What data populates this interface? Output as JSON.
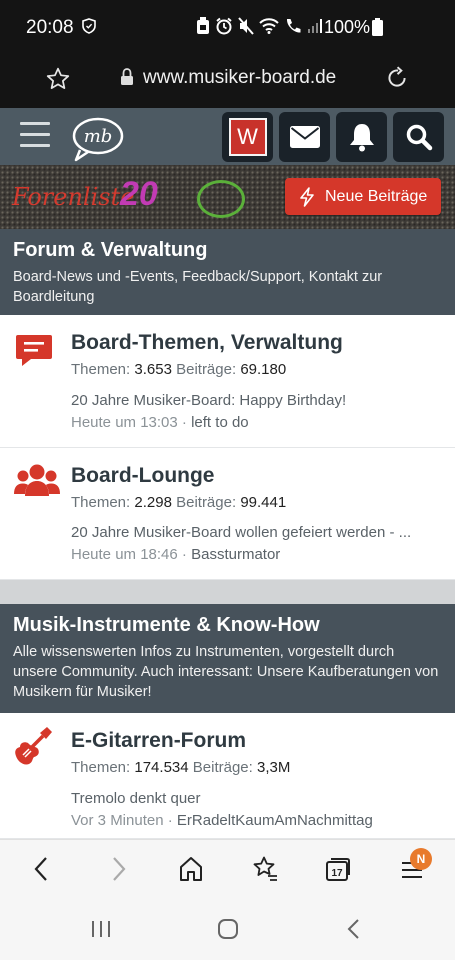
{
  "status": {
    "time": "20:08",
    "battery": "100%"
  },
  "browser": {
    "url": "www.musiker-board.de",
    "tab_count": "17",
    "menu_badge": "N"
  },
  "header": {
    "user_initial": "W"
  },
  "banner": {
    "text": "Forenliste",
    "number": "20",
    "new_posts_label": "Neue Beiträge"
  },
  "categories": [
    {
      "title": "Forum & Verwaltung",
      "description": "Board-News und -Events, Feedback/Support, Kontakt zur Boardleitung",
      "forums": [
        {
          "title": "Board-Themen, Verwaltung",
          "threads_label": "Themen:",
          "threads": "3.653",
          "posts_label": "Beiträge:",
          "posts": "69.180",
          "last_thread": "20 Jahre Musiker-Board: Happy Birthday!",
          "last_time": "Heute um 13:03",
          "last_user": "left to do",
          "icon": "chat-icon"
        },
        {
          "title": "Board-Lounge",
          "threads_label": "Themen:",
          "threads": "2.298",
          "posts_label": "Beiträge:",
          "posts": "99.441",
          "last_thread": "20 Jahre Musiker-Board wollen gefeiert werden - ...",
          "last_time": "Heute um 18:46",
          "last_user": "Bassturmator",
          "icon": "users-icon"
        }
      ]
    },
    {
      "title": "Musik-Instrumente & Know-How",
      "description": "Alle wissenswerten Infos zu Instrumenten, vorgestellt durch unsere Community. Auch interessant: Unsere Kaufberatungen von Musikern für Musiker!",
      "forums": [
        {
          "title": "E-Gitarren-Forum",
          "threads_label": "Themen:",
          "threads": "174.534",
          "posts_label": "Beiträge:",
          "posts": "3,3M",
          "last_thread": "Tremolo denkt quer",
          "last_time": "Vor 3 Minuten",
          "last_user": "ErRadeltKaumAmNachmittag",
          "icon": "guitar-icon"
        }
      ]
    }
  ],
  "colors": {
    "accent": "#d5372a",
    "header_bg": "#4d5a63",
    "category_bg": "#47525b"
  }
}
